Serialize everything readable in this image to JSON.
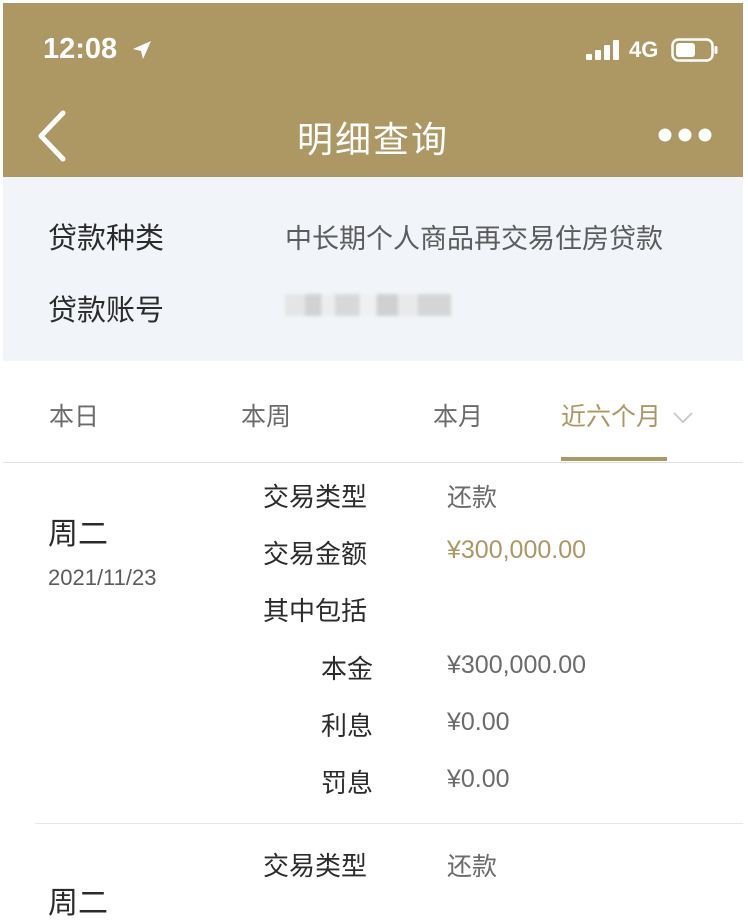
{
  "status_bar": {
    "time": "12:08",
    "network": "4G"
  },
  "header": {
    "title": "明细查询"
  },
  "loan_info": {
    "type_label": "贷款种类",
    "type_value": "中长期个人商品再交易住房贷款",
    "account_label": "贷款账号"
  },
  "tabs": [
    {
      "label": "本日"
    },
    {
      "label": "本周"
    },
    {
      "label": "本月"
    },
    {
      "label": "近六个月",
      "active": true
    }
  ],
  "records": [
    {
      "weekday": "周二",
      "date": "2021/11/23",
      "type_label": "交易类型",
      "type_value": "还款",
      "amount_label": "交易金额",
      "amount_value": "¥300,000.00",
      "includes_label": "其中包括",
      "principal_label": "本金",
      "principal_value": "¥300,000.00",
      "interest_label": "利息",
      "interest_value": "¥0.00",
      "penalty_label": "罚息",
      "penalty_value": "¥0.00"
    },
    {
      "weekday": "周二",
      "type_label": "交易类型",
      "type_value": "还款"
    }
  ],
  "colors": {
    "brand": "#ad9864",
    "info_bg": "#f1f4f8"
  },
  "icons": [
    "location-arrow-icon",
    "signal-icon",
    "battery-icon",
    "back-chevron-icon",
    "more-icon",
    "chevron-down-icon"
  ]
}
